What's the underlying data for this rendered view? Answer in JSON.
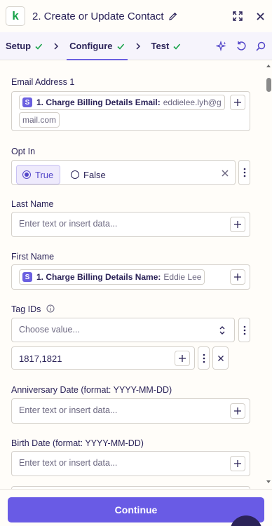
{
  "header": {
    "logo_letter": "k",
    "title": "2. Create or Update Contact"
  },
  "tabs": [
    {
      "label": "Setup"
    },
    {
      "label": "Configure"
    },
    {
      "label": "Test"
    }
  ],
  "fields": {
    "email": {
      "label": "Email Address 1",
      "pill_badge": "S",
      "pill_label": "1. Charge Billing Details Email:",
      "pill_value_line1": "eddielee.lyh@g",
      "pill_value_line2": "mail.com"
    },
    "opt_in": {
      "label": "Opt In",
      "option_true": "True",
      "option_false": "False",
      "selected": "True"
    },
    "last_name": {
      "label": "Last Name",
      "placeholder": "Enter text or insert data..."
    },
    "first_name": {
      "label": "First Name",
      "pill_badge": "S",
      "pill_label": "1. Charge Billing Details Name:",
      "pill_value": "Eddie Lee"
    },
    "tag_ids": {
      "label": "Tag IDs",
      "select_placeholder": "Choose value...",
      "value": "1817,1821"
    },
    "anniversary": {
      "label": "Anniversary Date (format: YYYY-MM-DD)",
      "placeholder": "Enter text or insert data..."
    },
    "birth_date": {
      "label": "Birth Date (format: YYYY-MM-DD)",
      "placeholder": "Enter text or insert data..."
    }
  },
  "footer": {
    "continue_label": "Continue"
  },
  "colors": {
    "accent": "#695be5",
    "success": "#18a34a",
    "text": "#2b2358"
  }
}
